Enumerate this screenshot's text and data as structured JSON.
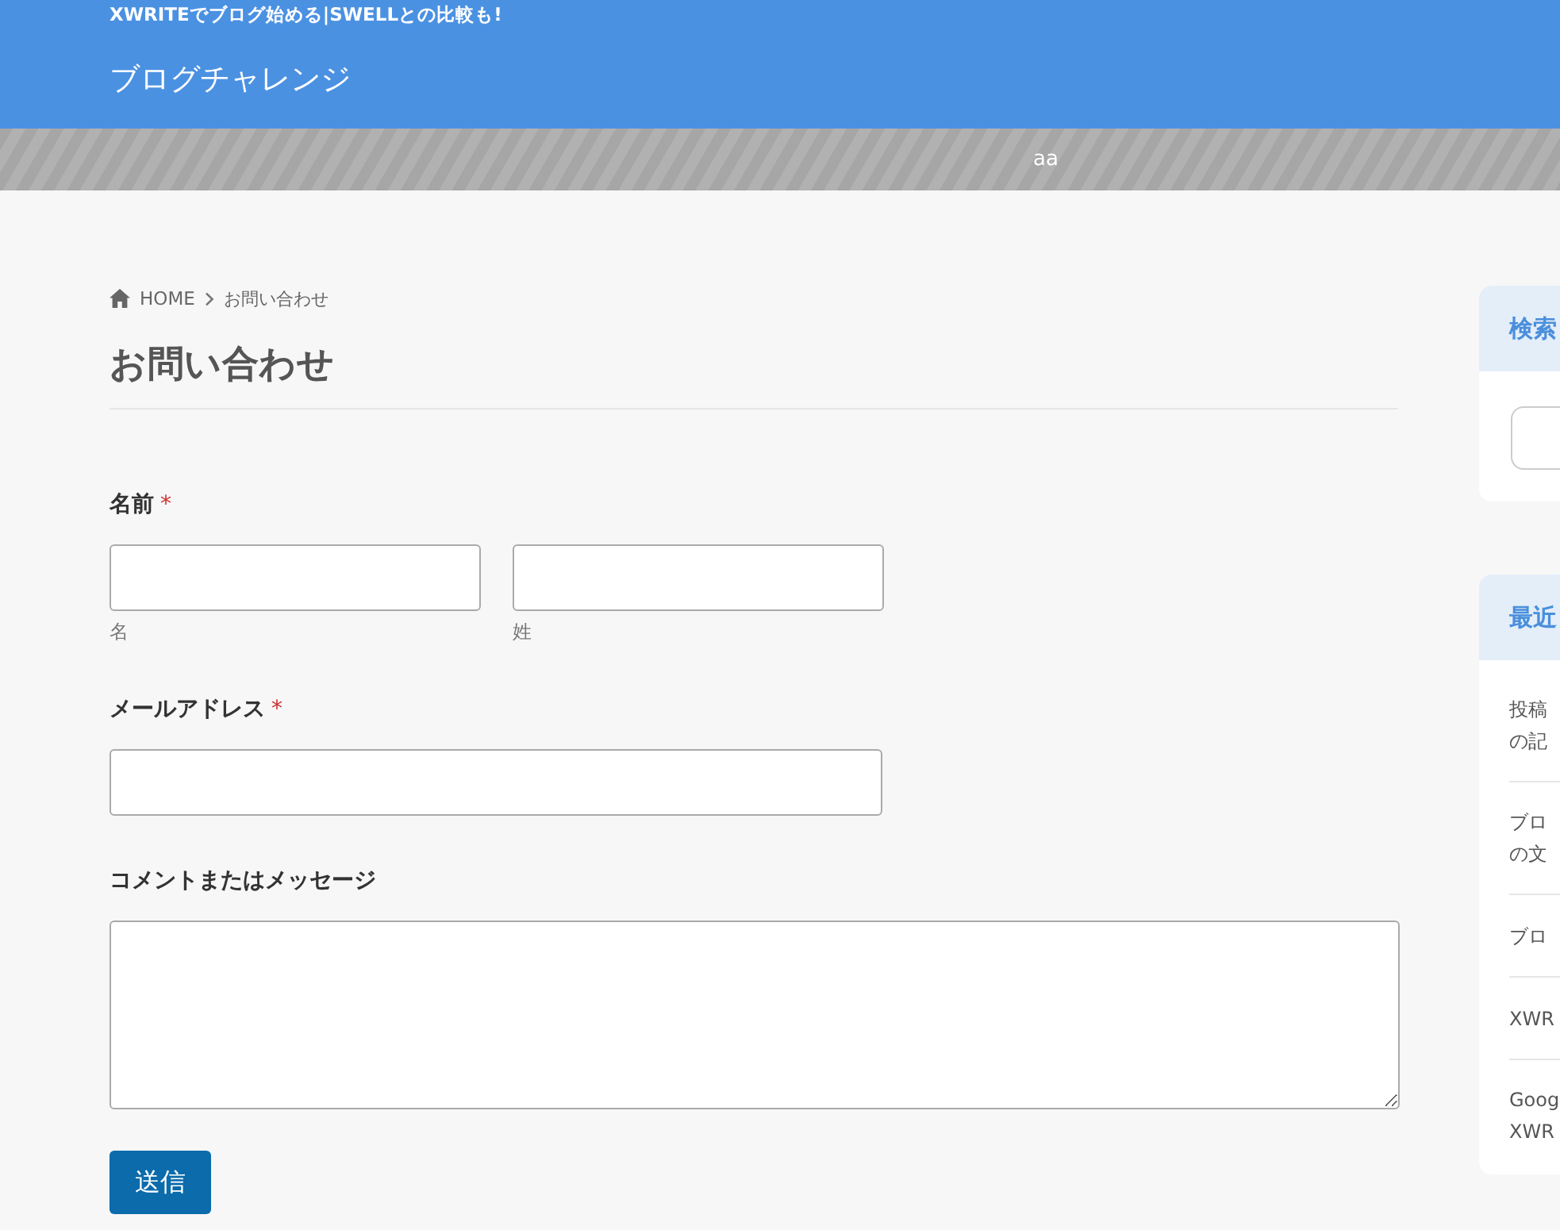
{
  "header": {
    "tagline": "XWRITEでブログ始める|SWELLとの比較も!",
    "site_title": "ブログチャレンジ"
  },
  "banner": {
    "text": "aa"
  },
  "breadcrumb": [
    {
      "kind": "home",
      "label": "HOME"
    },
    {
      "kind": "current",
      "label": "お問い合わせ"
    }
  ],
  "page_title": "お問い合わせ",
  "form": {
    "required_mark": "*",
    "fields": [
      {
        "kind": "name",
        "label": "名前",
        "required": true,
        "parts": [
          {
            "sublabel": "名"
          },
          {
            "sublabel": "姓"
          }
        ]
      },
      {
        "kind": "email",
        "label": "メールアドレス",
        "required": true
      },
      {
        "kind": "textarea",
        "label": "コメントまたはメッセージ",
        "required": false
      }
    ],
    "submit": "送信"
  },
  "sidebar": {
    "widgets": [
      {
        "kind": "search",
        "title": "検索"
      },
      {
        "kind": "list",
        "title": "最近",
        "items": [
          {
            "lines": [
              "投稿",
              "の記"
            ]
          },
          {
            "lines": [
              "ブロ",
              "の文"
            ]
          },
          {
            "lines": [
              "ブロ"
            ]
          },
          {
            "lines": [
              "XWR"
            ]
          },
          {
            "lines": [
              "Goog",
              "XWR"
            ]
          }
        ]
      }
    ]
  }
}
